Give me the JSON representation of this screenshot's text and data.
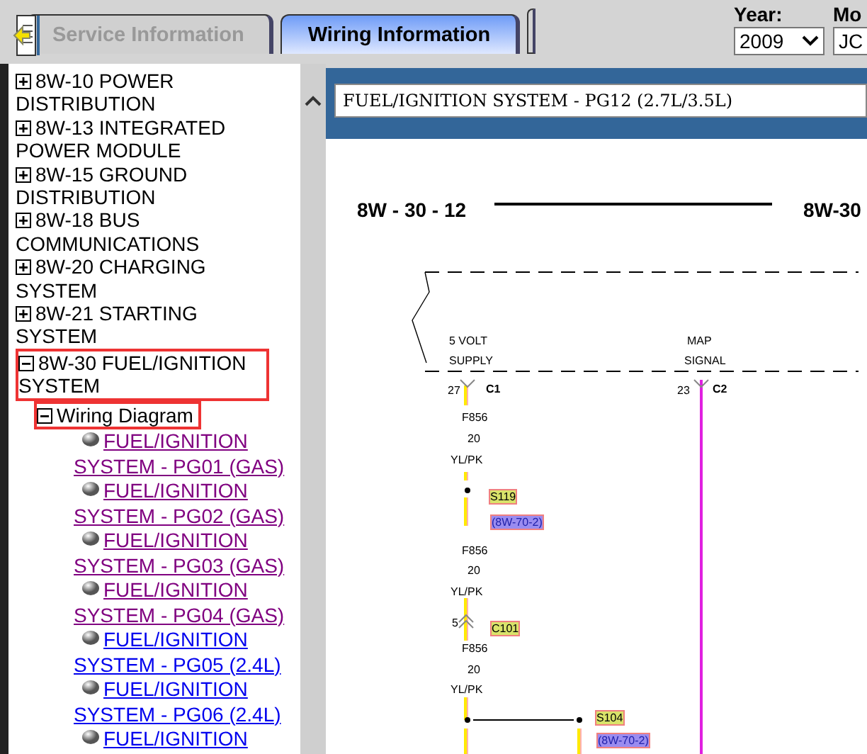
{
  "tabs": [
    {
      "label": "Service Information",
      "selected": false
    },
    {
      "label": "Wiring Information",
      "selected": true
    }
  ],
  "filters": [
    {
      "label": "Year:",
      "value": "2009"
    },
    {
      "label": "Mo",
      "value": "JC"
    }
  ],
  "tree": [
    {
      "label": "8W-10 POWER DISTRIBUTION",
      "expanded": false,
      "highlighted": false
    },
    {
      "label": "8W-13 INTEGRATED POWER MODULE",
      "expanded": false,
      "highlighted": false
    },
    {
      "label": "8W-15 GROUND DISTRIBUTION",
      "expanded": false,
      "highlighted": false
    },
    {
      "label": "8W-18 BUS COMMUNICATIONS",
      "expanded": false,
      "highlighted": false
    },
    {
      "label": "8W-20 CHARGING SYSTEM",
      "expanded": false,
      "highlighted": false
    },
    {
      "label": "8W-21 STARTING SYSTEM",
      "expanded": false,
      "highlighted": false
    },
    {
      "label": "8W-30 FUEL/IGNITION SYSTEM",
      "expanded": true,
      "highlighted": true,
      "children": [
        {
          "label": "Wiring Diagram",
          "expanded": true,
          "highlighted": true,
          "children": [
            {
              "label": "FUEL/IGNITION SYSTEM - PG01 (GAS)",
              "visited": true
            },
            {
              "label": "FUEL/IGNITION SYSTEM - PG02 (GAS)",
              "visited": true
            },
            {
              "label": "FUEL/IGNITION SYSTEM - PG03 (GAS)",
              "visited": true
            },
            {
              "label": "FUEL/IGNITION SYSTEM - PG04 (GAS)",
              "visited": true
            },
            {
              "label": "FUEL/IGNITION SYSTEM - PG05 (2.4L)",
              "visited": false
            },
            {
              "label": "FUEL/IGNITION SYSTEM - PG06 (2.4L)",
              "visited": false
            },
            {
              "label": "FUEL/IGNITION",
              "visited": false
            }
          ]
        }
      ]
    }
  ],
  "viewer": {
    "title": "FUEL/IGNITION SYSTEM - PG12 (2.7L/3.5L)",
    "diagram": {
      "labels": [
        {
          "kind": "page",
          "text": "8W - 30 - 12"
        },
        {
          "kind": "page",
          "text": "8W-30"
        },
        {
          "kind": "text",
          "text": "5 VOLT"
        },
        {
          "kind": "text",
          "text": "SUPPLY"
        },
        {
          "kind": "text",
          "text": "MAP"
        },
        {
          "kind": "text",
          "text": "SIGNAL"
        },
        {
          "kind": "text",
          "text": "27"
        },
        {
          "kind": "bold",
          "text": "C1"
        },
        {
          "kind": "text",
          "text": "23"
        },
        {
          "kind": "bold",
          "text": "C2"
        },
        {
          "kind": "text",
          "text": "F856"
        },
        {
          "kind": "text",
          "text": "20"
        },
        {
          "kind": "text",
          "text": "YL/PK"
        },
        {
          "kind": "splice",
          "text": "S119"
        },
        {
          "kind": "ref",
          "text": "(8W-70-2)"
        },
        {
          "kind": "text",
          "text": "F856"
        },
        {
          "kind": "text",
          "text": "20"
        },
        {
          "kind": "text",
          "text": "YL/PK"
        },
        {
          "kind": "text",
          "text": "5"
        },
        {
          "kind": "splice",
          "text": "C101"
        },
        {
          "kind": "text",
          "text": "F856"
        },
        {
          "kind": "text",
          "text": "20"
        },
        {
          "kind": "text",
          "text": "YL/PK"
        },
        {
          "kind": "splice",
          "text": "S104"
        },
        {
          "kind": "ref",
          "text": "(8W-70-2)"
        }
      ]
    }
  }
}
